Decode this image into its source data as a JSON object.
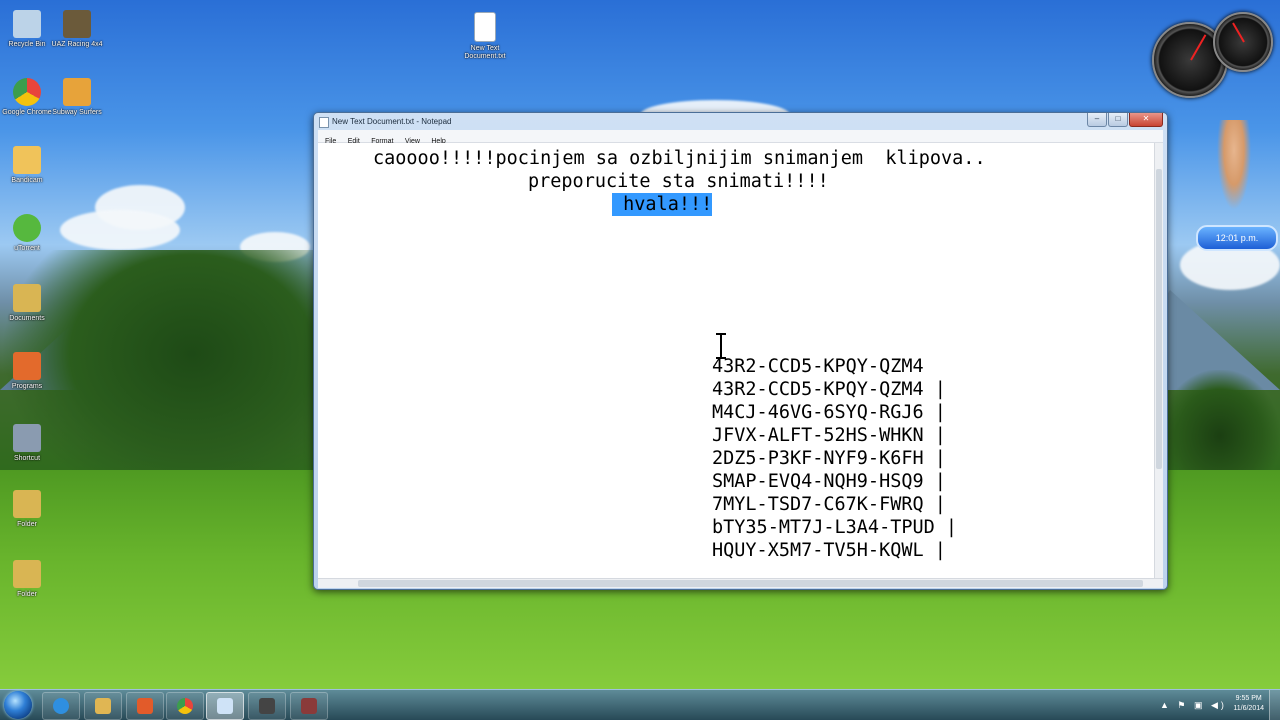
{
  "desktop": {
    "icons": [
      {
        "label": "Recycle Bin",
        "icon": "recycle-bin-icon",
        "color": "#bcd3e8"
      },
      {
        "label": "UAZ Racing 4x4",
        "icon": "uaz-racing-icon",
        "color": "#6b5a3a"
      },
      {
        "label": "Google Chrome",
        "icon": "chrome-icon",
        "color": "#e8453c"
      },
      {
        "label": "Subway Surfers",
        "icon": "subway-surfers-icon",
        "color": "#e7a33a"
      },
      {
        "label": "Bandicam",
        "icon": "bandicam-icon",
        "color": "#f0c35a"
      },
      {
        "label": "uTorrent",
        "icon": "utorrent-icon",
        "color": "#56b83e"
      },
      {
        "label": "Documents",
        "icon": "folder-icon",
        "color": "#d9b553"
      },
      {
        "label": "Programs",
        "icon": "app-icon",
        "color": "#e36a2c"
      },
      {
        "label": "Shortcut",
        "icon": "shortcut-icon",
        "color": "#8a9bb0"
      },
      {
        "label": "Folder",
        "icon": "folder-icon",
        "color": "#d9b553"
      },
      {
        "label": "Folder",
        "icon": "folder-icon",
        "color": "#d9b553"
      },
      {
        "label": "New Text Document.txt",
        "icon": "text-file-icon",
        "color": "#ffffff"
      }
    ]
  },
  "gadgets": {
    "clock_text": "12:01 p.m."
  },
  "window": {
    "title": "New Text Document.txt - Notepad",
    "menu": [
      "File",
      "Edit",
      "Format",
      "View",
      "Help"
    ],
    "lines": {
      "l1": "caoooo!!!!!pocinjem sa ozbiljnijim snimanjem  klipova..",
      "l2": "preporucite sta snimati!!!!",
      "l3_selected": " hvala!!!",
      "k1": "43R2-CCD5-KPQY-QZM4",
      "k2": "43R2-CCD5-KPQY-QZM4 |",
      "k3": "M4CJ-46VG-6SYQ-RGJ6 |",
      "k4": "JFVX-ALFT-52HS-WHKN |",
      "k5": "2DZ5-P3KF-NYF9-K6FH |",
      "k6": "SMAP-EVQ4-NQH9-HSQ9 |",
      "k7": "7MYL-TSD7-C67K-FWRQ |",
      "k8": "bTY35-MT7J-L3A4-TPUD |",
      "k9": "HQUY-X5M7-TV5H-KQWL |"
    },
    "buttons": {
      "minimize": "–",
      "maximize": "□",
      "close": "✕"
    }
  },
  "taskbar": {
    "pinned": [
      {
        "name": "ie-icon",
        "color": "#2f8fe0"
      },
      {
        "name": "explorer-icon",
        "color": "#e0b653"
      },
      {
        "name": "media-player-icon",
        "color": "#e25b2a"
      },
      {
        "name": "chrome-icon",
        "color": "#e8453c"
      },
      {
        "name": "notepad-icon",
        "color": "#cfe3f7"
      },
      {
        "name": "app-icon",
        "color": "#444444"
      },
      {
        "name": "app-icon",
        "color": "#8a3a3a"
      }
    ],
    "clock": {
      "time": "9:55 PM",
      "date": "11/6/2014"
    }
  }
}
